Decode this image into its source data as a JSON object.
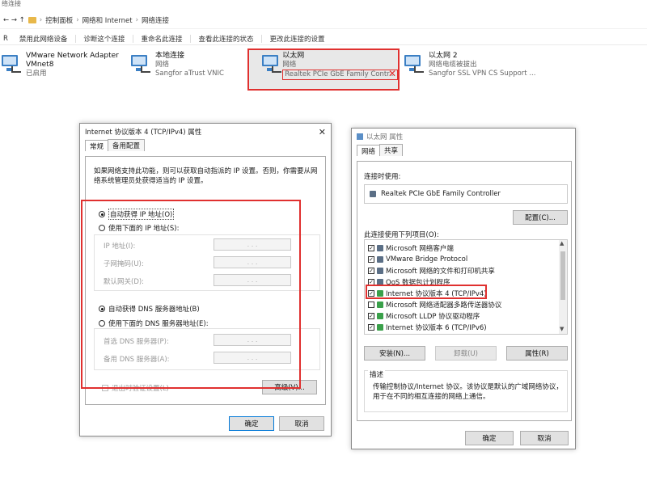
{
  "window": {
    "title": "络连接",
    "breadcrumb": [
      "控制面板",
      "网络和 Internet",
      "网络连接"
    ],
    "arrows": "←  →  ↑",
    "toolbar_left": "R",
    "toolbar": [
      "禁用此网络设备",
      "诊断这个连接",
      "重命名此连接",
      "查看此连接的状态",
      "更改此连接的设置"
    ]
  },
  "adapters": [
    {
      "name": "VMware Network Adapter",
      "line2": "VMnet8",
      "line3": "已启用"
    },
    {
      "name": "本地连接",
      "line2": "网络",
      "line3": "Sangfor aTrust VNIC"
    },
    {
      "name": "以太网",
      "line2": "网络",
      "line3": "Realtek PCIe GbE Family Contr..."
    },
    {
      "name": "以太网 2",
      "line2": "网络电缆被拔出",
      "line3": "Sangfor SSL VPN CS Support ..."
    }
  ],
  "ipv4_dialog": {
    "title": "Internet 协议版本 4 (TCP/IPv4) 属性",
    "close": "✕",
    "tabs": [
      "常规",
      "备用配置"
    ],
    "description": "如果网络支持此功能，则可以获取自动指派的 IP 设置。否则，你需要从网络系统管理员处获得适当的 IP 设置。",
    "auto_ip": "自动获得 IP 地址(O)",
    "manual_ip": "使用下面的 IP 地址(S):",
    "ip_label": "IP 地址(I):",
    "mask_label": "子网掩码(U):",
    "gateway_label": "默认网关(D):",
    "auto_dns": "自动获得 DNS 服务器地址(B)",
    "manual_dns": "使用下面的 DNS 服务器地址(E):",
    "dns1_label": "首选 DNS 服务器(P):",
    "dns2_label": "备用 DNS 服务器(A):",
    "ip_dots": ".   .   .",
    "validate_label": "退出时验证设置(L)",
    "advanced_button": "高级(V)...",
    "ok_button": "确定",
    "cancel_button": "取消"
  },
  "eth_dialog": {
    "title": "以太网 属性",
    "tabs": [
      "网络",
      "共享"
    ],
    "connect_using_label": "连接时使用:",
    "adapter_name": "Realtek PCIe GbE Family Controller",
    "configure_button": "配置(C)...",
    "items_label": "此连接使用下列项目(O):",
    "items": [
      {
        "label": "Microsoft 网络客户端",
        "checked": true
      },
      {
        "label": "VMware Bridge Protocol",
        "checked": true
      },
      {
        "label": "Microsoft 网络的文件和打印机共享",
        "checked": true
      },
      {
        "label": "QoS 数据包计划程序",
        "checked": true
      },
      {
        "label": "Internet 协议版本 4 (TCP/IPv4)",
        "checked": true
      },
      {
        "label": "Microsoft 网络适配器多路传送器协议",
        "checked": false
      },
      {
        "label": "Microsoft LLDP 协议驱动程序",
        "checked": true
      },
      {
        "label": "Internet 协议版本 6 (TCP/IPv6)",
        "checked": true
      }
    ],
    "install_button": "安装(N)...",
    "uninstall_button": "卸载(U)",
    "properties_button": "属性(R)",
    "description_label": "描述",
    "description": "传输控制协议/Internet 协议。该协议是默认的广域网络协议，用于在不同的相互连接的网络上通信。",
    "ok_button": "确定",
    "cancel_button": "取消"
  },
  "colors": {
    "highlight": "#e0302f",
    "accent": "#0078d7"
  }
}
